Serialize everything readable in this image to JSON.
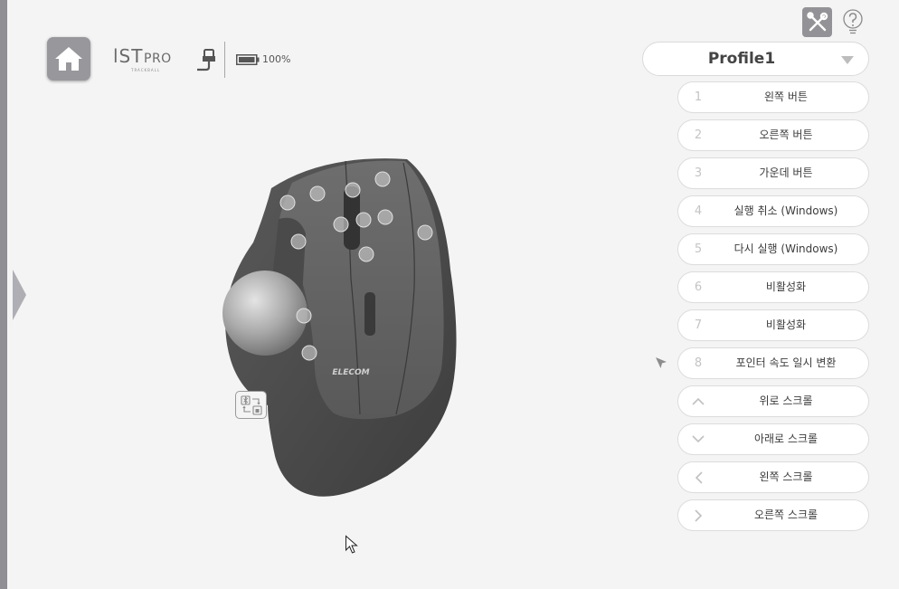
{
  "header": {
    "logo_main": "lST",
    "logo_pro": "PRO",
    "logo_sub": "TRACKBALL",
    "battery": "100%"
  },
  "profile": {
    "selected": "Profile1"
  },
  "buttons": [
    {
      "num": "1",
      "label": "왼쪽 버튼"
    },
    {
      "num": "2",
      "label": "오른쪽 버튼"
    },
    {
      "num": "3",
      "label": "가운데 버튼"
    },
    {
      "num": "4",
      "label": "실행 취소 (Windows)"
    },
    {
      "num": "5",
      "label": "다시 실행 (Windows)"
    },
    {
      "num": "6",
      "label": "비활성화"
    },
    {
      "num": "7",
      "label": "비활성화"
    },
    {
      "num": "8",
      "label": "포인터 속도 일시 변환"
    },
    {
      "icon": "chevron-up-icon",
      "label": "위로 스크롤"
    },
    {
      "icon": "chevron-down-icon",
      "label": "아래로 스크롤"
    },
    {
      "icon": "chevron-left-icon",
      "label": "왼쪽 스크롤"
    },
    {
      "icon": "chevron-right-icon",
      "label": "오른쪽 스크롤"
    }
  ],
  "mouse": {
    "brand": "ELECOM"
  },
  "colors": {
    "accent_gray": "#939397",
    "page_bg": "#f4f4f4",
    "left_bar": "#8f8f95"
  }
}
